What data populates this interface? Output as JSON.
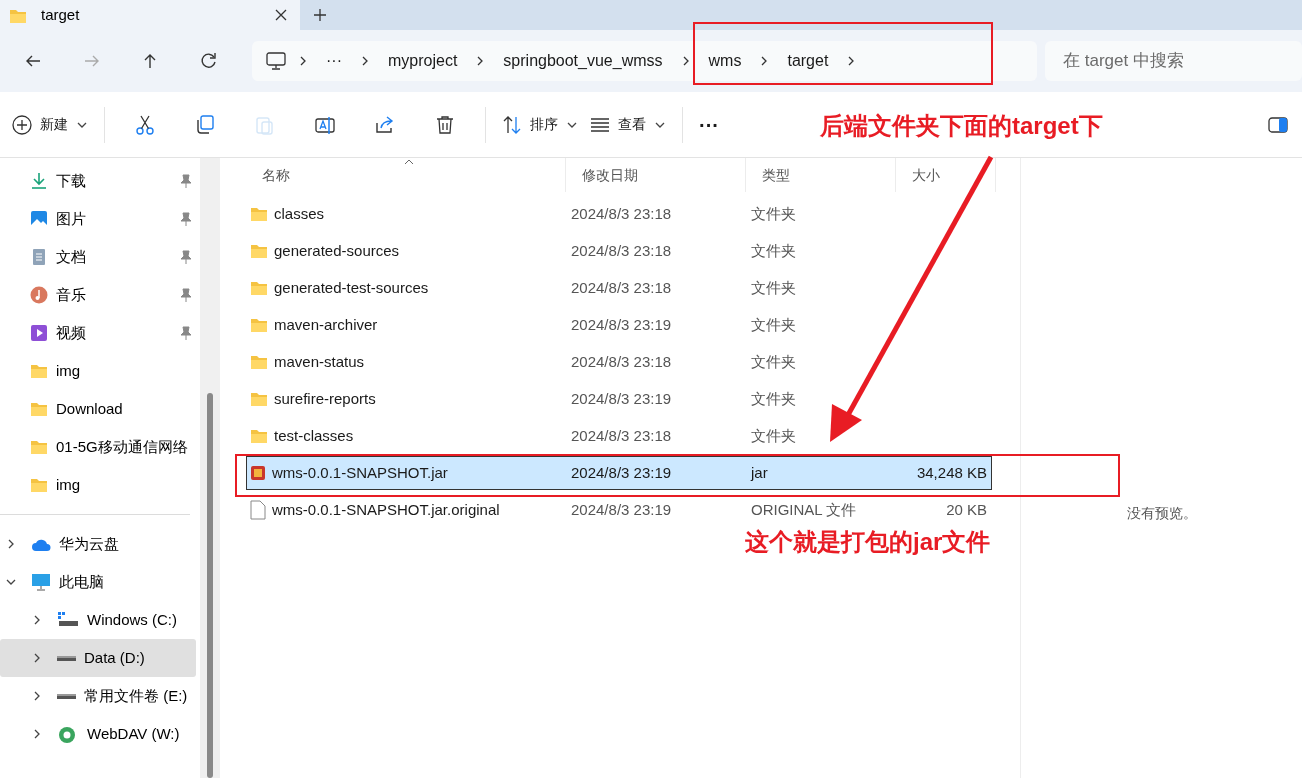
{
  "tab": {
    "title": "target",
    "selected": true
  },
  "address": {
    "overflow": "···",
    "crumbs": [
      "myproject",
      "springboot_vue_wmss",
      "wms",
      "target"
    ]
  },
  "search": {
    "placeholder": "在 target 中搜索"
  },
  "toolbar": [
    {
      "kind": "new",
      "label": "新建"
    },
    {
      "kind": "cut"
    },
    {
      "kind": "copy"
    },
    {
      "kind": "paste",
      "disabled": true
    },
    {
      "kind": "rename"
    },
    {
      "kind": "share"
    },
    {
      "kind": "delete"
    },
    {
      "kind": "sort",
      "label": "排序"
    },
    {
      "kind": "view",
      "label": "查看"
    },
    {
      "kind": "more",
      "label": "···"
    }
  ],
  "sidebar": {
    "quick_access": [
      {
        "label": "下载",
        "kind": "download",
        "pinned": true
      },
      {
        "label": "图片",
        "kind": "pictures",
        "pinned": true
      },
      {
        "label": "文档",
        "kind": "document",
        "pinned": true
      },
      {
        "label": "音乐",
        "kind": "music",
        "pinned": true
      },
      {
        "label": "视频",
        "kind": "video",
        "pinned": true
      },
      {
        "label": "img",
        "kind": "folder",
        "pinned": false
      },
      {
        "label": "Download",
        "kind": "folder",
        "pinned": false
      },
      {
        "label": "01-5G移动通信网络",
        "kind": "folder",
        "pinned": false
      },
      {
        "label": "img",
        "kind": "folder",
        "pinned": false
      }
    ],
    "tree": [
      {
        "label": "华为云盘",
        "kind": "cloud",
        "expanded": false,
        "selected": false
      },
      {
        "label": "此电脑",
        "kind": "pc",
        "expanded": true,
        "selected": false,
        "children": [
          {
            "label": "Windows (C:)",
            "kind": "drive-windows",
            "expanded": false,
            "selected": false
          },
          {
            "label": "Data (D:)",
            "kind": "drive",
            "expanded": false,
            "selected": true
          },
          {
            "label": "常用文件卷 (E:)",
            "kind": "drive",
            "expanded": false,
            "selected": false
          },
          {
            "label": "WebDAV (W:)",
            "kind": "network",
            "expanded": false,
            "selected": false
          }
        ]
      }
    ]
  },
  "table": {
    "columns": [
      "名称",
      "修改日期",
      "类型",
      "大小"
    ],
    "rows": [
      {
        "name": "classes",
        "date": "2024/8/3 23:18",
        "type": "文件夹",
        "kind": "folder",
        "selected": false
      },
      {
        "name": "generated-sources",
        "date": "2024/8/3 23:18",
        "type": "文件夹",
        "kind": "folder",
        "selected": false
      },
      {
        "name": "generated-test-sources",
        "date": "2024/8/3 23:18",
        "type": "文件夹",
        "kind": "folder",
        "selected": false
      },
      {
        "name": "maven-archiver",
        "date": "2024/8/3 23:19",
        "type": "文件夹",
        "kind": "folder",
        "selected": false
      },
      {
        "name": "maven-status",
        "date": "2024/8/3 23:18",
        "type": "文件夹",
        "kind": "folder",
        "selected": false
      },
      {
        "name": "surefire-reports",
        "date": "2024/8/3 23:19",
        "type": "文件夹",
        "kind": "folder",
        "selected": false
      },
      {
        "name": "test-classes",
        "date": "2024/8/3 23:18",
        "type": "文件夹",
        "kind": "folder",
        "selected": false
      },
      {
        "name": "wms-0.0.1-SNAPSHOT.jar",
        "date": "2024/8/3 23:19",
        "type": "jar",
        "size": "34,248 KB",
        "kind": "jar",
        "selected": true
      },
      {
        "name": "wms-0.0.1-SNAPSHOT.jar.original",
        "date": "2024/8/3 23:19",
        "type": "ORIGINAL 文件",
        "size": "20 KB",
        "kind": "file",
        "selected": false
      }
    ]
  },
  "preview": {
    "message": "没有预览。"
  },
  "annotations": [
    {
      "text": "后端文件夹下面的target下"
    },
    {
      "text": "这个就是打包的jar文件"
    }
  ]
}
